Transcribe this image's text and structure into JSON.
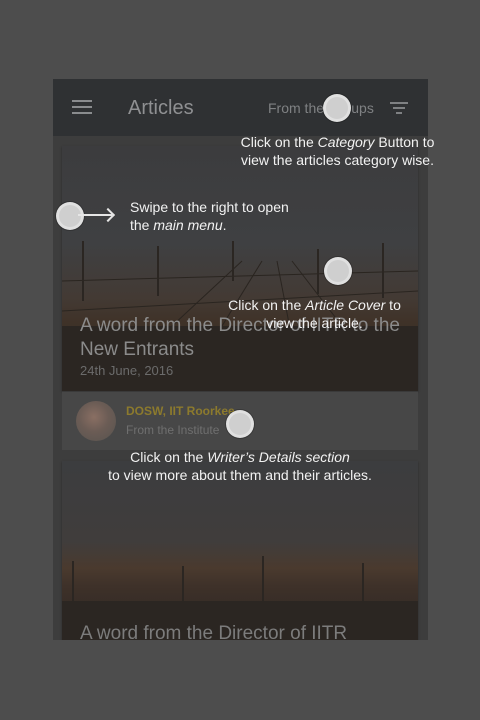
{
  "appbar": {
    "title": "Articles",
    "filter_label": "From the Groups"
  },
  "articles": [
    {
      "title": "A word from the Director of IITR to the New Entrants",
      "date": "24th June, 2016"
    },
    {
      "title": "A word from the Director of IITR"
    }
  ],
  "writer": {
    "name": "DOSW, IIT Roorkee",
    "subtitle": "From the Institute"
  },
  "tips": {
    "category": {
      "prefix": "Click on the ",
      "emph": "Category",
      "suffix": " Button to",
      "line2": "view the articles category wise."
    },
    "swipe": {
      "line1": "Swipe to the right to open",
      "prefix": "the ",
      "emph": "main menu",
      "suffix": "."
    },
    "cover": {
      "prefix": "Click on the ",
      "emph": "Article Cover",
      "suffix": " to",
      "line2": "view the article."
    },
    "writer": {
      "prefix": "Click on the ",
      "emph": "Writer’s Details section",
      "line2": "to view more about them and their articles."
    }
  }
}
